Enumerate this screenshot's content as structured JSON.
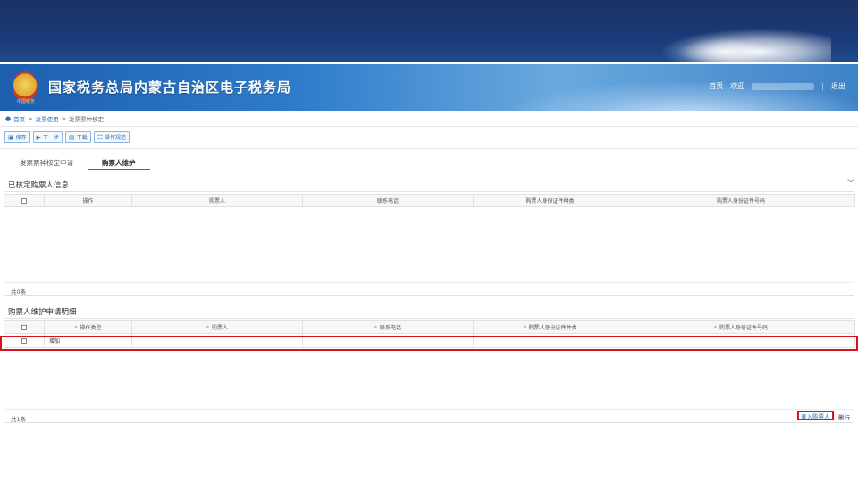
{
  "banner": {
    "title": "国家税务总局内蒙古自治区电子税务局",
    "emblem_text": "中国税务",
    "links": {
      "home": "首页",
      "welcome": "欢迎",
      "logout": "退出",
      "sep": "|"
    }
  },
  "breadcrumb": {
    "home": "首页",
    "sep": ">",
    "level1": "发票使用",
    "level2": "发票票种核定"
  },
  "toolbar": [
    {
      "icon": "▣",
      "label": "保存"
    },
    {
      "icon": "▶",
      "label": "下一步"
    },
    {
      "icon": "▤",
      "label": "下载"
    },
    {
      "icon": "☷",
      "label": "操作规范"
    }
  ],
  "tabs": [
    {
      "label": "发票票种核定申请",
      "active": false
    },
    {
      "label": "购票人维护",
      "active": true
    }
  ],
  "section1": {
    "title": "已核定购票人信息",
    "columns": [
      "操作",
      "购票人",
      "联系电话",
      "购票人身份证件种类",
      "购票人身份证件号码"
    ],
    "count": "共0条"
  },
  "section2": {
    "title": "购票人维护申请明细",
    "columns": [
      "操作类型",
      "购票人",
      "联系电话",
      "购票人身份证件种类",
      "购票人身份证件号码"
    ],
    "required_mark": "*",
    "rows": [
      {
        "op_type": "增加"
      }
    ],
    "count": "共1条",
    "add_label": "录入购票人",
    "delete_label": "删行"
  },
  "colors": {
    "accent": "#2c6fbb",
    "highlight": "#d4141a"
  }
}
